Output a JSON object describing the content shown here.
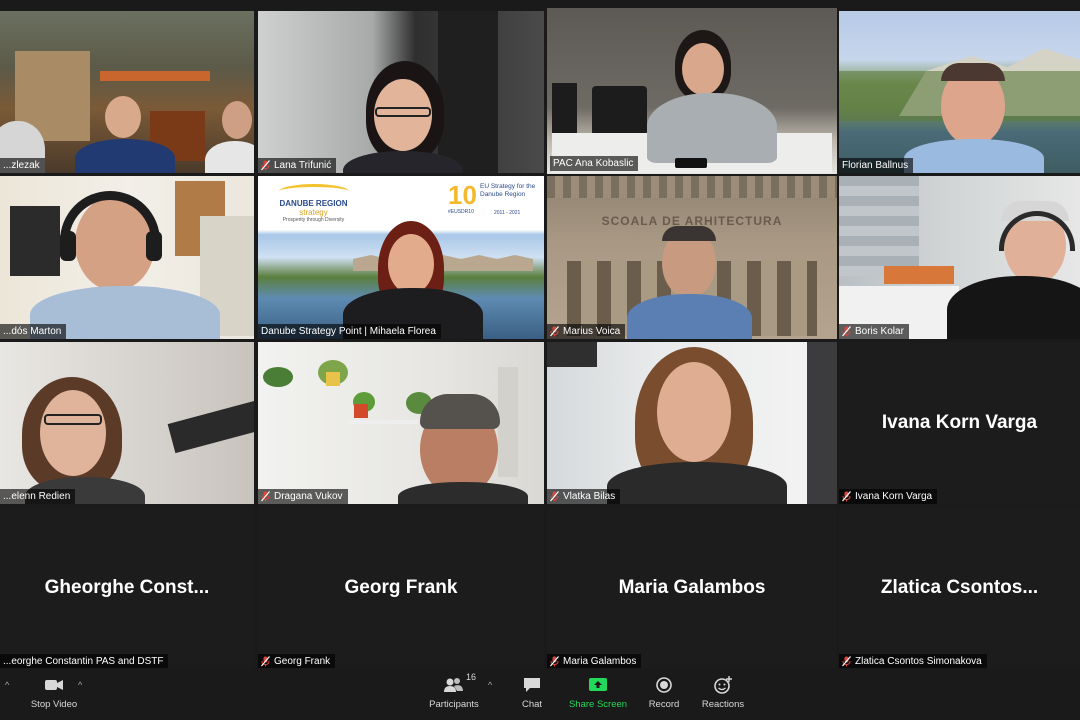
{
  "participants_grid": [
    {
      "name": "...zlezak",
      "muted": false,
      "kind": "video"
    },
    {
      "name": "Lana Trifunić",
      "muted": true,
      "kind": "video"
    },
    {
      "name": "PAC Ana Kobaslic",
      "muted": false,
      "kind": "video",
      "active_speaker": true
    },
    {
      "name": "Florian Ballnus",
      "muted": false,
      "kind": "video"
    },
    {
      "name": "...dós Marton",
      "muted": false,
      "kind": "video"
    },
    {
      "name": "Danube Strategy Point | Mihaela Florea",
      "muted": false,
      "kind": "video"
    },
    {
      "name": "Marius Voica",
      "muted": true,
      "kind": "video"
    },
    {
      "name": "Boris Kolar",
      "muted": true,
      "kind": "video"
    },
    {
      "name": "...elenn Redien",
      "muted": false,
      "kind": "video"
    },
    {
      "name": "Dragana Vukov",
      "muted": true,
      "kind": "video"
    },
    {
      "name": "Vlatka Bilas",
      "muted": true,
      "kind": "video"
    },
    {
      "name": "Ivana Korn Varga",
      "muted": true,
      "kind": "placeholder",
      "display": "Ivana Korn Varga"
    },
    {
      "name": "...eorghe Constantin PAS and DSTF",
      "muted": false,
      "kind": "placeholder",
      "display": "Gheorghe  Const..."
    },
    {
      "name": "Georg Frank",
      "muted": true,
      "kind": "placeholder",
      "display": "Georg Frank"
    },
    {
      "name": "Maria Galambos",
      "muted": true,
      "kind": "placeholder",
      "display": "Maria Galambos"
    },
    {
      "name": "Zlatica Csontos Simonakova",
      "muted": true,
      "kind": "placeholder",
      "display": "Zlatica  Csontos..."
    }
  ],
  "banner": {
    "logo_title": "DANUBE REGION",
    "logo_sub": "strategy",
    "logo_tag": "Prosperity through Diversity",
    "anniv_number": "10",
    "anniv_tag": "#EUSDR10",
    "anniv_title": "EU Strategy for the Danube Region",
    "anniv_years": "2011 - 2021"
  },
  "building_sign": "SCOALA DE ARHITECTURA",
  "toolbar": {
    "stop_video": "Stop Video",
    "participants": "Participants",
    "participants_count": "16",
    "chat": "Chat",
    "share_screen": "Share Screen",
    "record": "Record",
    "reactions": "Reactions"
  },
  "colors": {
    "active_speaker_border": "#c6d845",
    "muted_icon": "#e0443c",
    "share_green": "#23d959"
  }
}
